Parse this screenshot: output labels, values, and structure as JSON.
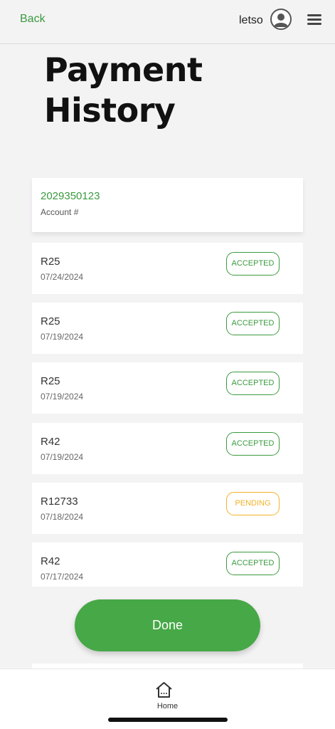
{
  "header": {
    "back_label": "Back",
    "username": "letso",
    "avatar_icon": "user-avatar-icon",
    "menu_icon": "hamburger-menu-icon"
  },
  "page": {
    "title": "Payment History"
  },
  "account": {
    "number": "2029350123",
    "label": "Account #"
  },
  "payments": [
    {
      "amount": "R25",
      "date": "07/24/2024",
      "status": "ACCEPTED"
    },
    {
      "amount": "R25",
      "date": "07/19/2024",
      "status": "ACCEPTED"
    },
    {
      "amount": "R25",
      "date": "07/19/2024",
      "status": "ACCEPTED"
    },
    {
      "amount": "R42",
      "date": "07/19/2024",
      "status": "ACCEPTED"
    },
    {
      "amount": "R12733",
      "date": "07/18/2024",
      "status": "PENDING"
    },
    {
      "amount": "R42",
      "date": "07/17/2024",
      "status": "ACCEPTED"
    }
  ],
  "actions": {
    "done_label": "Done"
  },
  "tabbar": {
    "home_label": "Home",
    "home_icon": "home-icon"
  },
  "colors": {
    "accent_green": "#3a9a3f",
    "button_green": "#46a846",
    "pending_amber": "#f2b227",
    "background": "#f4f3f4"
  }
}
